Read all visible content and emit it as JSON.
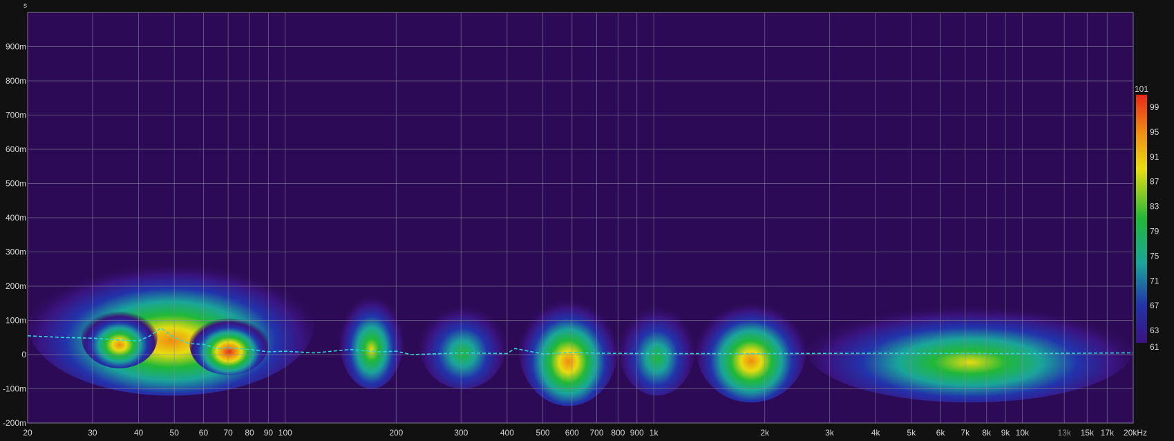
{
  "chart_data": {
    "type": "heatmap",
    "title": "",
    "xlabel": "",
    "ylabel": "",
    "y_unit": "s",
    "x_scale": "log",
    "x_unit_label": "kHz",
    "xlim": [
      20,
      20000
    ],
    "ylim": [
      -0.2,
      1.0
    ],
    "grid": true,
    "x_ticks": [
      {
        "value": 20,
        "label": "20",
        "dim": false
      },
      {
        "value": 30,
        "label": "30",
        "dim": false
      },
      {
        "value": 40,
        "label": "40",
        "dim": false
      },
      {
        "value": 50,
        "label": "50",
        "dim": false
      },
      {
        "value": 60,
        "label": "60",
        "dim": false
      },
      {
        "value": 70,
        "label": "70",
        "dim": false
      },
      {
        "value": 80,
        "label": "80",
        "dim": false
      },
      {
        "value": 90,
        "label": "90",
        "dim": false
      },
      {
        "value": 100,
        "label": "100",
        "dim": false
      },
      {
        "value": 200,
        "label": "200",
        "dim": false
      },
      {
        "value": 300,
        "label": "300",
        "dim": false
      },
      {
        "value": 400,
        "label": "400",
        "dim": false
      },
      {
        "value": 500,
        "label": "500",
        "dim": false
      },
      {
        "value": 600,
        "label": "600",
        "dim": false
      },
      {
        "value": 700,
        "label": "700",
        "dim": false
      },
      {
        "value": 800,
        "label": "800",
        "dim": false
      },
      {
        "value": 900,
        "label": "900",
        "dim": false
      },
      {
        "value": 1000,
        "label": "1k",
        "dim": false
      },
      {
        "value": 2000,
        "label": "2k",
        "dim": false
      },
      {
        "value": 3000,
        "label": "3k",
        "dim": false
      },
      {
        "value": 4000,
        "label": "4k",
        "dim": false
      },
      {
        "value": 5000,
        "label": "5k",
        "dim": false
      },
      {
        "value": 6000,
        "label": "6k",
        "dim": false
      },
      {
        "value": 7000,
        "label": "7k",
        "dim": false
      },
      {
        "value": 8000,
        "label": "8k",
        "dim": false
      },
      {
        "value": 9000,
        "label": "9k",
        "dim": false
      },
      {
        "value": 10000,
        "label": "10k",
        "dim": false
      },
      {
        "value": 13000,
        "label": "13k",
        "dim": true
      },
      {
        "value": 15000,
        "label": "15k",
        "dim": false
      },
      {
        "value": 17000,
        "label": "17k",
        "dim": false
      },
      {
        "value": 20000,
        "label": "20kHz",
        "dim": false
      }
    ],
    "y_ticks": [
      {
        "value": 0.9,
        "label": "900m"
      },
      {
        "value": 0.8,
        "label": "800m"
      },
      {
        "value": 0.7,
        "label": "700m"
      },
      {
        "value": 0.6,
        "label": "600m"
      },
      {
        "value": 0.5,
        "label": "500m"
      },
      {
        "value": 0.4,
        "label": "400m"
      },
      {
        "value": 0.3,
        "label": "300m"
      },
      {
        "value": 0.2,
        "label": "200m"
      },
      {
        "value": 0.1,
        "label": "100m"
      },
      {
        "value": 0.0,
        "label": "0"
      },
      {
        "value": -0.1,
        "label": "-100m"
      },
      {
        "value": -0.2,
        "label": "-200m"
      }
    ],
    "colorbar": {
      "min": 61,
      "max": 101,
      "tick_labels": [
        "101",
        "99",
        "95",
        "91",
        "87",
        "83",
        "79",
        "75",
        "71",
        "67",
        "63",
        "61"
      ],
      "tick_values": [
        101,
        99,
        95,
        91,
        87,
        83,
        79,
        75,
        71,
        67,
        63,
        61
      ]
    },
    "colors": {
      "background": "#2d0a55",
      "low": "#3a1480",
      "blue": "#2233aa",
      "teal": "#1aa59a",
      "green": "#20b838",
      "yellow": "#e8dc10",
      "orange": "#f08c10",
      "red": "#e82818",
      "peak_line": "#33d6d6"
    },
    "peak_time_curve": {
      "name": "",
      "x": [
        20,
        25,
        30,
        35,
        40,
        43,
        46,
        50,
        55,
        60,
        65,
        70,
        80,
        90,
        100,
        120,
        150,
        180,
        200,
        220,
        300,
        400,
        420,
        500,
        600,
        700,
        1000,
        2000,
        4000,
        10000,
        20000
      ],
      "y": [
        0.055,
        0.05,
        0.048,
        0.043,
        0.04,
        0.055,
        0.078,
        0.05,
        0.032,
        0.03,
        0.018,
        0.02,
        0.015,
        0.008,
        0.01,
        0.005,
        0.015,
        0.008,
        0.01,
        0.0,
        0.005,
        0.003,
        0.018,
        0.002,
        0.006,
        0.004,
        0.003,
        0.003,
        0.004,
        0.003,
        0.005
      ]
    },
    "energy_regions": [
      {
        "f0": 20,
        "f1": 120,
        "t0": -0.12,
        "t1": 0.3,
        "peak": 99
      },
      {
        "f0": 55,
        "f1": 90,
        "t0": -0.06,
        "t1": 0.12,
        "peak": 101
      },
      {
        "f0": 28,
        "f1": 45,
        "t0": -0.04,
        "t1": 0.14,
        "peak": 97
      },
      {
        "f0": 140,
        "f1": 210,
        "t0": -0.1,
        "t1": 0.2,
        "peak": 95
      },
      {
        "f0": 230,
        "f1": 400,
        "t0": -0.1,
        "t1": 0.17,
        "peak": 91
      },
      {
        "f0": 430,
        "f1": 800,
        "t0": -0.15,
        "t1": 0.19,
        "peak": 99
      },
      {
        "f0": 800,
        "f1": 1300,
        "t0": -0.12,
        "t1": 0.17,
        "peak": 91
      },
      {
        "f0": 1300,
        "f1": 2600,
        "t0": -0.14,
        "t1": 0.18,
        "peak": 97
      },
      {
        "f0": 2600,
        "f1": 20000,
        "t0": -0.14,
        "t1": 0.17,
        "peak": 93
      }
    ]
  }
}
